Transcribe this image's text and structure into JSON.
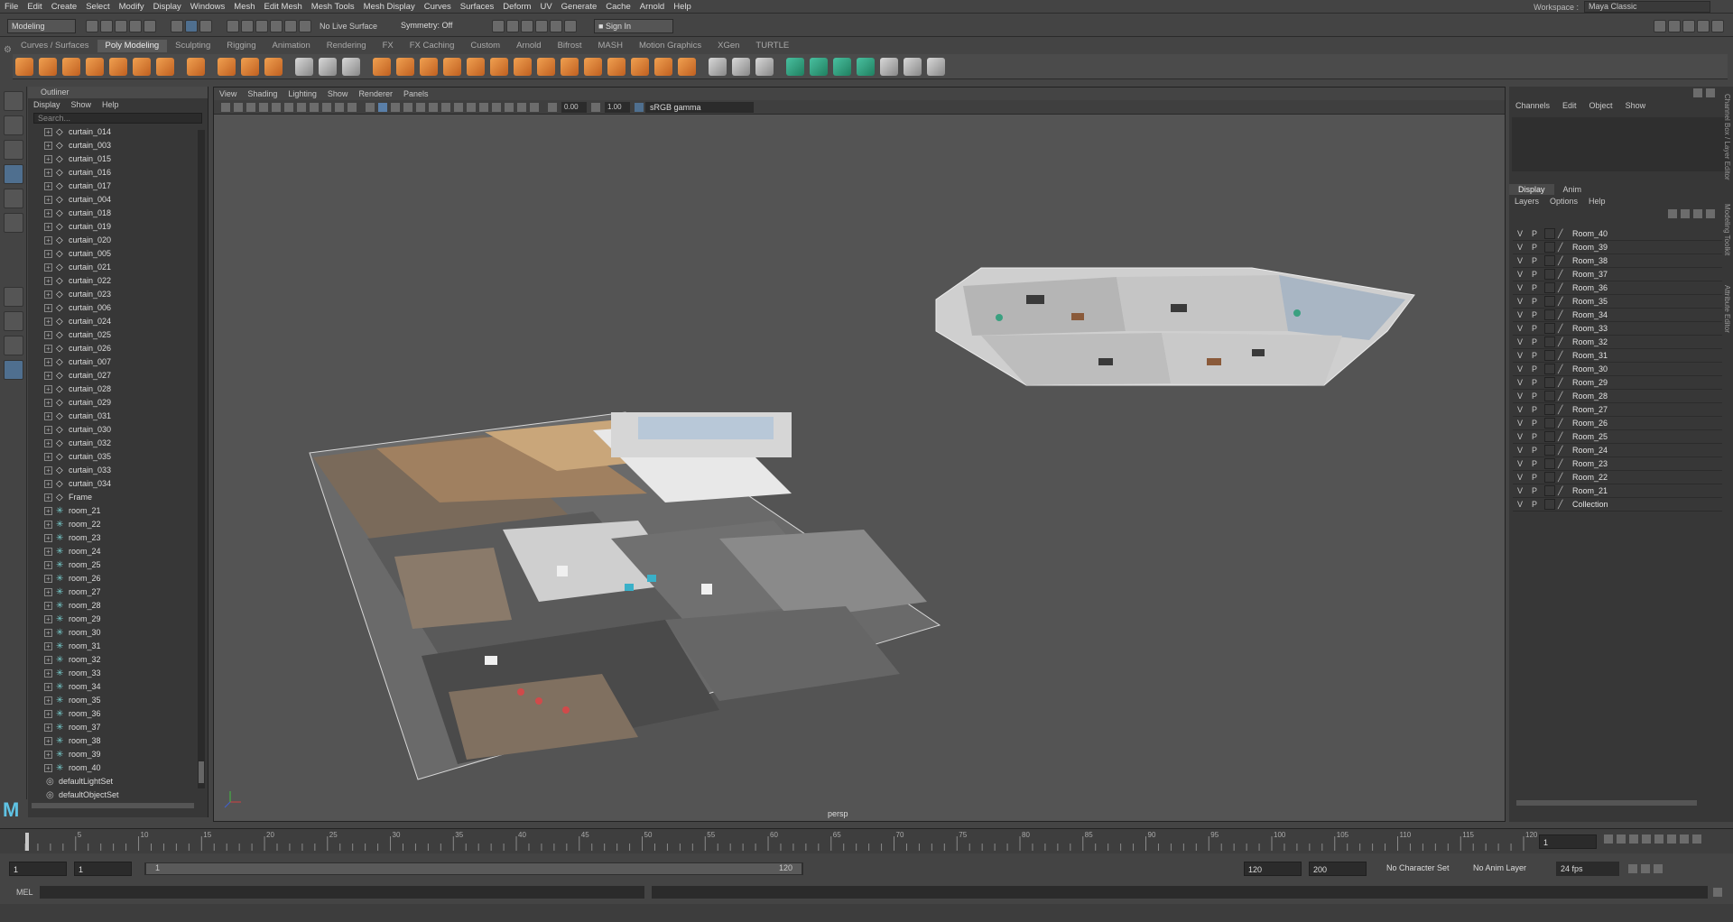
{
  "menubar": {
    "items": [
      "File",
      "Edit",
      "Create",
      "Select",
      "Modify",
      "Display",
      "Windows",
      "Mesh",
      "Edit Mesh",
      "Mesh Tools",
      "Mesh Display",
      "Curves",
      "Surfaces",
      "Deform",
      "UV",
      "Generate",
      "Cache",
      "Arnold",
      "Help"
    ],
    "workspace_label": "Workspace :",
    "workspace_value": "Maya Classic"
  },
  "statusline": {
    "mode": "Modeling",
    "live_surface": "No Live Surface",
    "symmetry": "Symmetry: Off",
    "sign_in": "Sign In"
  },
  "shelf": {
    "tabs": [
      "Curves / Surfaces",
      "Poly Modeling",
      "Sculpting",
      "Rigging",
      "Animation",
      "Rendering",
      "FX",
      "FX Caching",
      "Custom",
      "Arnold",
      "Bifrost",
      "MASH",
      "Motion Graphics",
      "XGen",
      "TURTLE"
    ],
    "active_tab": "Poly Modeling"
  },
  "outliner": {
    "title": "Outliner",
    "menu": [
      "Display",
      "Show",
      "Help"
    ],
    "search_placeholder": "Search...",
    "items": [
      {
        "name": "curtain_014",
        "type": "mesh"
      },
      {
        "name": "curtain_003",
        "type": "mesh"
      },
      {
        "name": "curtain_015",
        "type": "mesh"
      },
      {
        "name": "curtain_016",
        "type": "mesh"
      },
      {
        "name": "curtain_017",
        "type": "mesh"
      },
      {
        "name": "curtain_004",
        "type": "mesh"
      },
      {
        "name": "curtain_018",
        "type": "mesh"
      },
      {
        "name": "curtain_019",
        "type": "mesh"
      },
      {
        "name": "curtain_020",
        "type": "mesh"
      },
      {
        "name": "curtain_005",
        "type": "mesh"
      },
      {
        "name": "curtain_021",
        "type": "mesh"
      },
      {
        "name": "curtain_022",
        "type": "mesh"
      },
      {
        "name": "curtain_023",
        "type": "mesh"
      },
      {
        "name": "curtain_006",
        "type": "mesh"
      },
      {
        "name": "curtain_024",
        "type": "mesh"
      },
      {
        "name": "curtain_025",
        "type": "mesh"
      },
      {
        "name": "curtain_026",
        "type": "mesh"
      },
      {
        "name": "curtain_007",
        "type": "mesh"
      },
      {
        "name": "curtain_027",
        "type": "mesh"
      },
      {
        "name": "curtain_028",
        "type": "mesh"
      },
      {
        "name": "curtain_029",
        "type": "mesh"
      },
      {
        "name": "curtain_031",
        "type": "mesh"
      },
      {
        "name": "curtain_030",
        "type": "mesh"
      },
      {
        "name": "curtain_032",
        "type": "mesh"
      },
      {
        "name": "curtain_035",
        "type": "mesh"
      },
      {
        "name": "curtain_033",
        "type": "mesh"
      },
      {
        "name": "curtain_034",
        "type": "mesh"
      },
      {
        "name": "Frame",
        "type": "mesh"
      },
      {
        "name": "room_21",
        "type": "group"
      },
      {
        "name": "room_22",
        "type": "group"
      },
      {
        "name": "room_23",
        "type": "group"
      },
      {
        "name": "room_24",
        "type": "group"
      },
      {
        "name": "room_25",
        "type": "group"
      },
      {
        "name": "room_26",
        "type": "group"
      },
      {
        "name": "room_27",
        "type": "group"
      },
      {
        "name": "room_28",
        "type": "group"
      },
      {
        "name": "room_29",
        "type": "group"
      },
      {
        "name": "room_30",
        "type": "group"
      },
      {
        "name": "room_31",
        "type": "group"
      },
      {
        "name": "room_32",
        "type": "group"
      },
      {
        "name": "room_33",
        "type": "group"
      },
      {
        "name": "room_34",
        "type": "group"
      },
      {
        "name": "room_35",
        "type": "group"
      },
      {
        "name": "room_36",
        "type": "group"
      },
      {
        "name": "room_37",
        "type": "group"
      },
      {
        "name": "room_38",
        "type": "group"
      },
      {
        "name": "room_39",
        "type": "group"
      },
      {
        "name": "room_40",
        "type": "group"
      },
      {
        "name": "defaultLightSet",
        "type": "set"
      },
      {
        "name": "defaultObjectSet",
        "type": "set"
      }
    ]
  },
  "viewport": {
    "menu": [
      "View",
      "Shading",
      "Lighting",
      "Show",
      "Renderer",
      "Panels"
    ],
    "exposure": "0.00",
    "gamma": "1.00",
    "color_space": "sRGB gamma",
    "camera_label": "persp"
  },
  "channelbox": {
    "menu": [
      "Channels",
      "Edit",
      "Object",
      "Show"
    ],
    "layer_tabs": [
      "Display",
      "Anim"
    ],
    "layer_menu": [
      "Layers",
      "Options",
      "Help"
    ],
    "layers": [
      "Room_40",
      "Room_39",
      "Room_38",
      "Room_37",
      "Room_36",
      "Room_35",
      "Room_34",
      "Room_33",
      "Room_32",
      "Room_31",
      "Room_30",
      "Room_29",
      "Room_28",
      "Room_27",
      "Room_26",
      "Room_25",
      "Room_24",
      "Room_23",
      "Room_22",
      "Room_21",
      "Collection"
    ],
    "v_label": "V",
    "p_label": "P",
    "side_tabs": [
      "Channel Box / Layer Editor",
      "Modeling Toolkit",
      "Attribute Editor"
    ]
  },
  "timeline": {
    "ticks": [
      "5",
      "10",
      "15",
      "20",
      "25",
      "30",
      "35",
      "40",
      "45",
      "50",
      "55",
      "60",
      "65",
      "70",
      "75",
      "80",
      "85",
      "90",
      "95",
      "100",
      "105",
      "110",
      "115",
      "120"
    ],
    "current_frame": "1"
  },
  "range": {
    "start": "1",
    "playback_start": "1",
    "slider_start": "1",
    "slider_end": "120",
    "playback_end": "120",
    "end": "200",
    "character_set": "No Character Set",
    "anim_layer": "No Anim Layer",
    "fps": "24 fps"
  },
  "command": {
    "label": "MEL"
  }
}
